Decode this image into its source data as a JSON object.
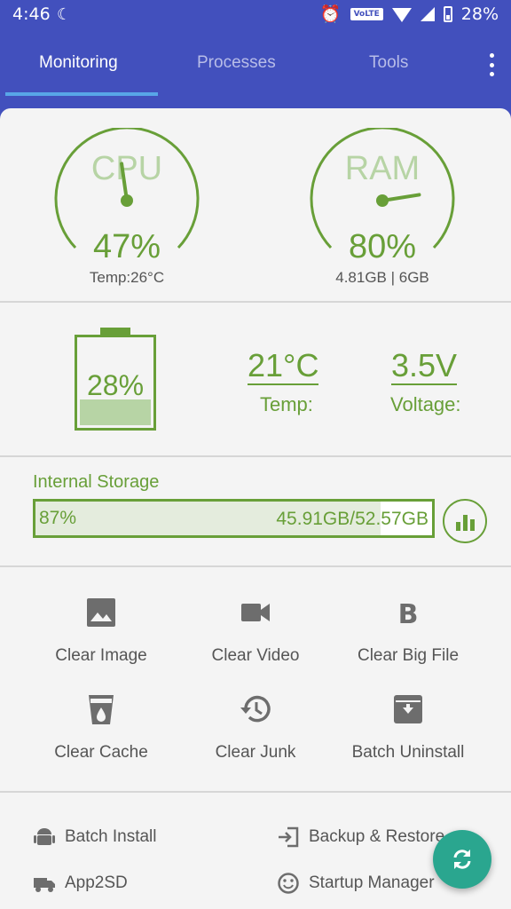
{
  "status_bar": {
    "time": "4:46",
    "volte": "VoLTE",
    "battery": "28%"
  },
  "tabs": [
    {
      "label": "Monitoring",
      "active": true
    },
    {
      "label": "Processes",
      "active": false
    },
    {
      "label": "Tools",
      "active": false
    }
  ],
  "gauges": {
    "cpu": {
      "label": "CPU",
      "value": "47%",
      "sub": "Temp:26°C",
      "level": 0.47
    },
    "ram": {
      "label": "RAM",
      "value": "80%",
      "sub": "4.81GB | 6GB",
      "level": 0.8
    }
  },
  "battery": {
    "percent": "28%",
    "level": 0.28,
    "temp": "21°C",
    "temp_label": "Temp:",
    "voltage": "3.5V",
    "voltage_label": "Voltage:"
  },
  "storage": {
    "title": "Internal Storage",
    "percent": "87%",
    "amount": "45.91GB/52.57GB",
    "level": 0.87
  },
  "tools": [
    {
      "label": "Clear Image",
      "icon": "image-icon"
    },
    {
      "label": "Clear Video",
      "icon": "video-icon"
    },
    {
      "label": "Clear Big File",
      "icon": "bold-b-icon"
    },
    {
      "label": "Clear Cache",
      "icon": "cup-icon"
    },
    {
      "label": "Clear Junk",
      "icon": "history-icon"
    },
    {
      "label": "Batch Uninstall",
      "icon": "archive-icon"
    }
  ],
  "links": {
    "batch_install": "Batch Install",
    "backup_restore": "Backup & Restore",
    "app2sd": "App2SD",
    "startup_manager": "Startup Manager"
  },
  "colors": {
    "primary": "#4250bd",
    "accent_green": "#689f38",
    "fab": "#2aa68f",
    "tab_indicator": "#58a6e8"
  }
}
